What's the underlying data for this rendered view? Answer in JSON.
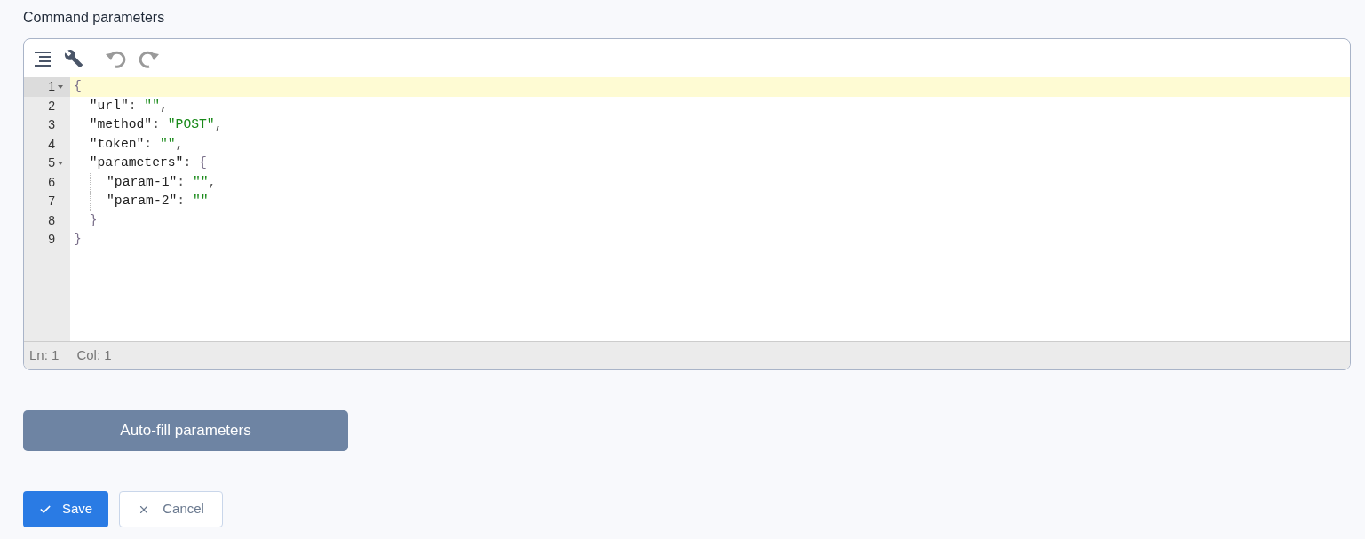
{
  "field_label": "Command parameters",
  "editor": {
    "toolbar": [
      {
        "kind": "format",
        "disabled": false
      },
      {
        "kind": "wrench",
        "disabled": false
      },
      {
        "kind": "undo",
        "disabled": true
      },
      {
        "kind": "redo",
        "disabled": true
      }
    ],
    "lines": [
      {
        "number": "1",
        "active": true,
        "foldable": true,
        "guide": false,
        "tokens": [
          {
            "kind": "brace",
            "text": "{"
          }
        ]
      },
      {
        "number": "2",
        "active": false,
        "foldable": false,
        "guide": false,
        "tokens": [
          {
            "kind": "key",
            "text": "  \"url\""
          },
          {
            "kind": "punct",
            "text": ": "
          },
          {
            "kind": "string",
            "text": "\"\""
          },
          {
            "kind": "punct",
            "text": ","
          }
        ]
      },
      {
        "number": "3",
        "active": false,
        "foldable": false,
        "guide": false,
        "tokens": [
          {
            "kind": "key",
            "text": "  \"method\""
          },
          {
            "kind": "punct",
            "text": ": "
          },
          {
            "kind": "string",
            "text": "\"POST\""
          },
          {
            "kind": "punct",
            "text": ","
          }
        ]
      },
      {
        "number": "4",
        "active": false,
        "foldable": false,
        "guide": false,
        "tokens": [
          {
            "kind": "key",
            "text": "  \"token\""
          },
          {
            "kind": "punct",
            "text": ": "
          },
          {
            "kind": "string",
            "text": "\"\""
          },
          {
            "kind": "punct",
            "text": ","
          }
        ]
      },
      {
        "number": "5",
        "active": false,
        "foldable": true,
        "guide": false,
        "tokens": [
          {
            "kind": "key",
            "text": "  \"parameters\""
          },
          {
            "kind": "punct",
            "text": ": "
          },
          {
            "kind": "brace",
            "text": "{"
          }
        ]
      },
      {
        "number": "6",
        "active": false,
        "foldable": false,
        "guide": true,
        "tokens": [
          {
            "kind": "key",
            "text": "\"param-1\""
          },
          {
            "kind": "punct",
            "text": ": "
          },
          {
            "kind": "string",
            "text": "\"\""
          },
          {
            "kind": "punct",
            "text": ","
          }
        ]
      },
      {
        "number": "7",
        "active": false,
        "foldable": false,
        "guide": true,
        "tokens": [
          {
            "kind": "key",
            "text": "\"param-2\""
          },
          {
            "kind": "punct",
            "text": ": "
          },
          {
            "kind": "string",
            "text": "\"\""
          }
        ]
      },
      {
        "number": "8",
        "active": false,
        "foldable": false,
        "guide": false,
        "tokens": [
          {
            "kind": "brace",
            "text": "  }"
          }
        ]
      },
      {
        "number": "9",
        "active": false,
        "foldable": false,
        "guide": false,
        "tokens": [
          {
            "kind": "brace",
            "text": "}"
          }
        ]
      }
    ],
    "status": [
      {
        "text": "Ln: 1"
      },
      {
        "text": "Col: 1"
      }
    ]
  },
  "autofill_button": "Auto-fill parameters",
  "actions": [
    {
      "kind": "primary",
      "label": "Save"
    },
    {
      "kind": "secondary",
      "label": "Cancel"
    }
  ]
}
